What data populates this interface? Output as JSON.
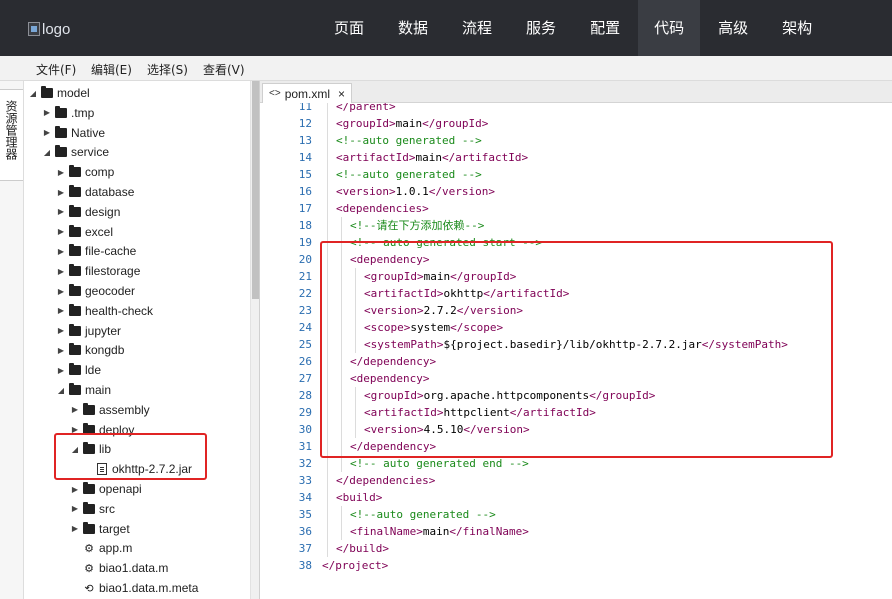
{
  "header": {
    "logo_alt": "logo",
    "nav": [
      {
        "label": "页面",
        "active": false
      },
      {
        "label": "数据",
        "active": false
      },
      {
        "label": "流程",
        "active": false
      },
      {
        "label": "服务",
        "active": false
      },
      {
        "label": "配置",
        "active": false
      },
      {
        "label": "代码",
        "active": true
      },
      {
        "label": "高级",
        "active": false
      },
      {
        "label": "架构",
        "active": false
      }
    ]
  },
  "menubar": {
    "file": "文件(F)",
    "edit": "编辑(E)",
    "select": "选择(S)",
    "view": "查看(V)"
  },
  "side_tab": {
    "label": "资源管理器"
  },
  "tree": [
    {
      "label": "model",
      "type": "folder",
      "depth": 0,
      "expanded": true
    },
    {
      "label": ".tmp",
      "type": "folder",
      "depth": 1,
      "expanded": false
    },
    {
      "label": "Native",
      "type": "folder",
      "depth": 1,
      "expanded": false
    },
    {
      "label": "service",
      "type": "folder",
      "depth": 1,
      "expanded": true
    },
    {
      "label": "comp",
      "type": "folder",
      "depth": 2,
      "expanded": false
    },
    {
      "label": "database",
      "type": "folder",
      "depth": 2,
      "expanded": false
    },
    {
      "label": "design",
      "type": "folder",
      "depth": 2,
      "expanded": false
    },
    {
      "label": "excel",
      "type": "folder",
      "depth": 2,
      "expanded": false
    },
    {
      "label": "file-cache",
      "type": "folder",
      "depth": 2,
      "expanded": false
    },
    {
      "label": "filestorage",
      "type": "folder",
      "depth": 2,
      "expanded": false
    },
    {
      "label": "geocoder",
      "type": "folder",
      "depth": 2,
      "expanded": false
    },
    {
      "label": "health-check",
      "type": "folder",
      "depth": 2,
      "expanded": false
    },
    {
      "label": "jupyter",
      "type": "folder",
      "depth": 2,
      "expanded": false
    },
    {
      "label": "kongdb",
      "type": "folder",
      "depth": 2,
      "expanded": false
    },
    {
      "label": "lde",
      "type": "folder",
      "depth": 2,
      "expanded": false
    },
    {
      "label": "main",
      "type": "folder",
      "depth": 2,
      "expanded": true
    },
    {
      "label": "assembly",
      "type": "folder",
      "depth": 3,
      "expanded": false
    },
    {
      "label": "deploy",
      "type": "folder",
      "depth": 3,
      "expanded": false
    },
    {
      "label": "lib",
      "type": "folder",
      "depth": 3,
      "expanded": true
    },
    {
      "label": "okhttp-2.7.2.jar",
      "type": "file",
      "depth": 4
    },
    {
      "label": "openapi",
      "type": "folder",
      "depth": 3,
      "expanded": false
    },
    {
      "label": "src",
      "type": "folder",
      "depth": 3,
      "expanded": false
    },
    {
      "label": "target",
      "type": "folder",
      "depth": 3,
      "expanded": false
    },
    {
      "label": "app.m",
      "type": "model",
      "depth": 3
    },
    {
      "label": "biao1.data.m",
      "type": "model",
      "depth": 3
    },
    {
      "label": "biao1.data.m.meta",
      "type": "meta",
      "depth": 3
    }
  ],
  "editor": {
    "tab_label": "pom.xml",
    "lines": [
      {
        "n": "11",
        "indent": 0,
        "parts": [
          [
            "tg",
            "</parent>"
          ]
        ]
      },
      {
        "n": "12",
        "indent": 0,
        "parts": [
          [
            "tg",
            "<groupId>"
          ],
          [
            "txt",
            "main"
          ],
          [
            "tg",
            "</groupId>"
          ]
        ]
      },
      {
        "n": "13",
        "indent": 0,
        "parts": [
          [
            "cm",
            "<!--auto generated -->"
          ]
        ]
      },
      {
        "n": "14",
        "indent": 0,
        "parts": [
          [
            "tg",
            "<artifactId>"
          ],
          [
            "txt",
            "main"
          ],
          [
            "tg",
            "</artifactId>"
          ]
        ]
      },
      {
        "n": "15",
        "indent": 0,
        "parts": [
          [
            "cm",
            "<!--auto generated -->"
          ]
        ]
      },
      {
        "n": "16",
        "indent": 0,
        "parts": [
          [
            "tg",
            "<version>"
          ],
          [
            "txt",
            "1.0.1"
          ],
          [
            "tg",
            "</version>"
          ]
        ]
      },
      {
        "n": "17",
        "indent": 0,
        "parts": [
          [
            "tg",
            "<dependencies>"
          ]
        ]
      },
      {
        "n": "18",
        "indent": 1,
        "parts": [
          [
            "cm",
            "<!--请在下方添加依赖-->"
          ]
        ]
      },
      {
        "n": "19",
        "indent": 1,
        "parts": [
          [
            "cm",
            "<!-- auto generated start -->"
          ]
        ]
      },
      {
        "n": "20",
        "indent": 1,
        "parts": [
          [
            "tg",
            "<dependency>"
          ]
        ]
      },
      {
        "n": "21",
        "indent": 2,
        "parts": [
          [
            "tg",
            "<groupId>"
          ],
          [
            "txt",
            "main"
          ],
          [
            "tg",
            "</groupId>"
          ]
        ]
      },
      {
        "n": "22",
        "indent": 2,
        "parts": [
          [
            "tg",
            "<artifactId>"
          ],
          [
            "txt",
            "okhttp"
          ],
          [
            "tg",
            "</artifactId>"
          ]
        ]
      },
      {
        "n": "23",
        "indent": 2,
        "parts": [
          [
            "tg",
            "<version>"
          ],
          [
            "txt",
            "2.7.2"
          ],
          [
            "tg",
            "</version>"
          ]
        ]
      },
      {
        "n": "24",
        "indent": 2,
        "parts": [
          [
            "tg",
            "<scope>"
          ],
          [
            "txt",
            "system"
          ],
          [
            "tg",
            "</scope>"
          ]
        ]
      },
      {
        "n": "25",
        "indent": 2,
        "parts": [
          [
            "tg",
            "<systemPath>"
          ],
          [
            "txt",
            "${project.basedir}/lib/okhttp-2.7.2.jar"
          ],
          [
            "tg",
            "</systemPath>"
          ]
        ]
      },
      {
        "n": "26",
        "indent": 1,
        "parts": [
          [
            "tg",
            "</dependency>"
          ]
        ]
      },
      {
        "n": "27",
        "indent": 1,
        "parts": [
          [
            "tg",
            "<dependency>"
          ]
        ]
      },
      {
        "n": "28",
        "indent": 2,
        "parts": [
          [
            "tg",
            "<groupId>"
          ],
          [
            "txt",
            "org.apache.httpcomponents"
          ],
          [
            "tg",
            "</groupId>"
          ]
        ]
      },
      {
        "n": "29",
        "indent": 2,
        "parts": [
          [
            "tg",
            "<artifactId>"
          ],
          [
            "txt",
            "httpclient"
          ],
          [
            "tg",
            "</artifactId>"
          ]
        ]
      },
      {
        "n": "30",
        "indent": 2,
        "parts": [
          [
            "tg",
            "<version>"
          ],
          [
            "txt",
            "4.5.10"
          ],
          [
            "tg",
            "</version>"
          ]
        ]
      },
      {
        "n": "31",
        "indent": 1,
        "parts": [
          [
            "tg",
            "</dependency>"
          ]
        ]
      },
      {
        "n": "32",
        "indent": 1,
        "parts": [
          [
            "cm",
            "<!-- auto generated end -->"
          ]
        ]
      },
      {
        "n": "33",
        "indent": 0,
        "parts": [
          [
            "tg",
            "</dependencies>"
          ]
        ]
      },
      {
        "n": "34",
        "indent": 0,
        "parts": [
          [
            "tg",
            "<build>"
          ]
        ]
      },
      {
        "n": "35",
        "indent": 1,
        "parts": [
          [
            "cm",
            "<!--auto generated -->"
          ]
        ]
      },
      {
        "n": "36",
        "indent": 1,
        "parts": [
          [
            "tg",
            "<finalName>"
          ],
          [
            "txt",
            "main"
          ],
          [
            "tg",
            "</finalName>"
          ]
        ]
      },
      {
        "n": "37",
        "indent": 0,
        "parts": [
          [
            "tg",
            "</build>"
          ]
        ]
      },
      {
        "n": "38",
        "indent": -1,
        "parts": [
          [
            "tg",
            "</project>"
          ]
        ]
      }
    ]
  },
  "colors": {
    "nav_bg": "#2a2c31",
    "tag": "#7f0055",
    "comment": "#1a8a1a",
    "line_number": "#2a6db0",
    "highlight": "#e02424"
  }
}
